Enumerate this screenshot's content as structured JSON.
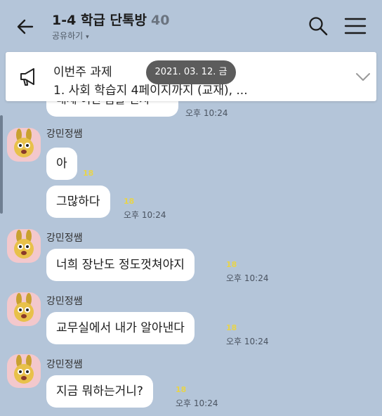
{
  "header": {
    "title": "1-4 학급 단톡방",
    "member_count": "40",
    "share_label": "공유하기",
    "share_caret": "▾"
  },
  "notice": {
    "title": "이번주 과제",
    "body": "1. 사회 학습지 4페이지까지 (교재), ..."
  },
  "date_divider": "2021. 03. 12. 금",
  "colors": {
    "background": "#b4c5d9",
    "bubble": "#ffffff",
    "unread": "#e8d44a",
    "avatar_bg": "#f3c8cc"
  },
  "messages": {
    "partial": {
      "text": "내세 어린 놈들 인지",
      "time": "오후 10:24"
    },
    "m1": {
      "sender": "강민정쌤",
      "text": "아",
      "unread": "18"
    },
    "m2": {
      "text": "그많하다",
      "unread": "18",
      "time": "오후 10:24"
    },
    "m3": {
      "sender": "강민정쌤",
      "text": "너희 장난도 정도껏쳐야지",
      "unread": "18",
      "time": "오후 10:24"
    },
    "m4": {
      "sender": "강민정쌤",
      "text": "교무실에서 내가 알아낸다",
      "unread": "18",
      "time": "오후 10:24"
    },
    "m5": {
      "sender": "강민정쌤",
      "text": "지금 뭐하는거니?",
      "unread": "18",
      "time": "오후 10:24"
    }
  }
}
